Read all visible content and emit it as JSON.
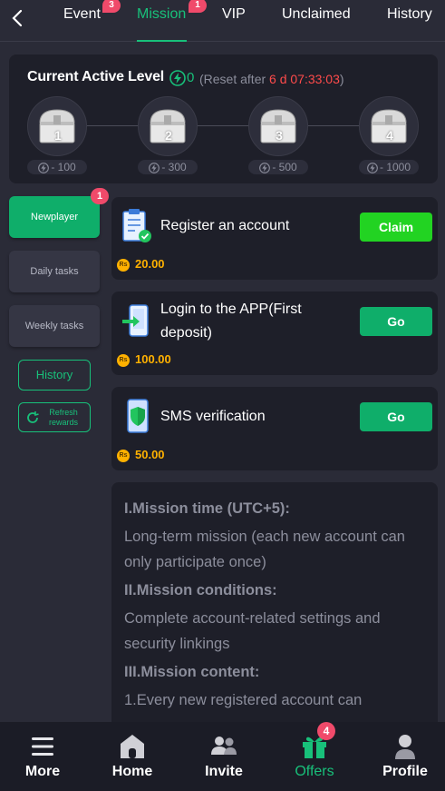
{
  "header": {
    "tabs": [
      {
        "label": "Event",
        "badge": "3"
      },
      {
        "label": "Mission",
        "badge": "1",
        "active": true
      },
      {
        "label": "VIP"
      },
      {
        "label": "Unclaimed"
      },
      {
        "label": "History"
      }
    ]
  },
  "level": {
    "title": "Current Active Level",
    "value": "0",
    "reset_prefix": "(Reset after ",
    "reset_time": "6 d 07:33:03",
    "reset_suffix": ")",
    "chests": [
      {
        "num": "1",
        "cost": "- 100"
      },
      {
        "num": "2",
        "cost": "- 300"
      },
      {
        "num": "3",
        "cost": "- 500"
      },
      {
        "num": "4",
        "cost": "- 1000"
      }
    ]
  },
  "sidebar": {
    "items": [
      {
        "label": "Newplayer",
        "active": true
      },
      {
        "label": "Daily tasks"
      },
      {
        "label": "Weekly tasks"
      }
    ],
    "badge": "1",
    "history_label": "History",
    "refresh_label_line1": "Refresh",
    "refresh_label_line2": "rewards"
  },
  "tasks": [
    {
      "name": "Register an account",
      "button": "Claim",
      "currency": "Rs",
      "reward": "20.00"
    },
    {
      "name_line1": "Login to the APP(First",
      "name_line2": "deposit)",
      "button": "Go",
      "currency": "Rs",
      "reward": "100.00"
    },
    {
      "name": "SMS verification",
      "button": "Go",
      "currency": "Rs",
      "reward": "50.00"
    }
  ],
  "rules": {
    "h1": "I.Mission time (UTC+5):",
    "p1": "Long-term mission (each new account can only participate once)",
    "h2": "II.Mission conditions:",
    "p2": "Complete account-related settings and security linkings",
    "h3": "III.Mission content:",
    "p3": "1.Every new registered account can"
  },
  "bottom_nav": {
    "items": [
      {
        "label": "More",
        "icon": "menu-icon"
      },
      {
        "label": "Home",
        "icon": "home-icon"
      },
      {
        "label": "Invite",
        "icon": "users-icon"
      },
      {
        "label": "Offers",
        "icon": "gift-icon",
        "badge": "4",
        "active": true
      },
      {
        "label": "Profile",
        "icon": "person-icon"
      }
    ]
  },
  "colors": {
    "accent": "#18c07a",
    "badge": "#f04a6a",
    "reward": "#ffb100",
    "countdown": "#ff4b4b"
  }
}
